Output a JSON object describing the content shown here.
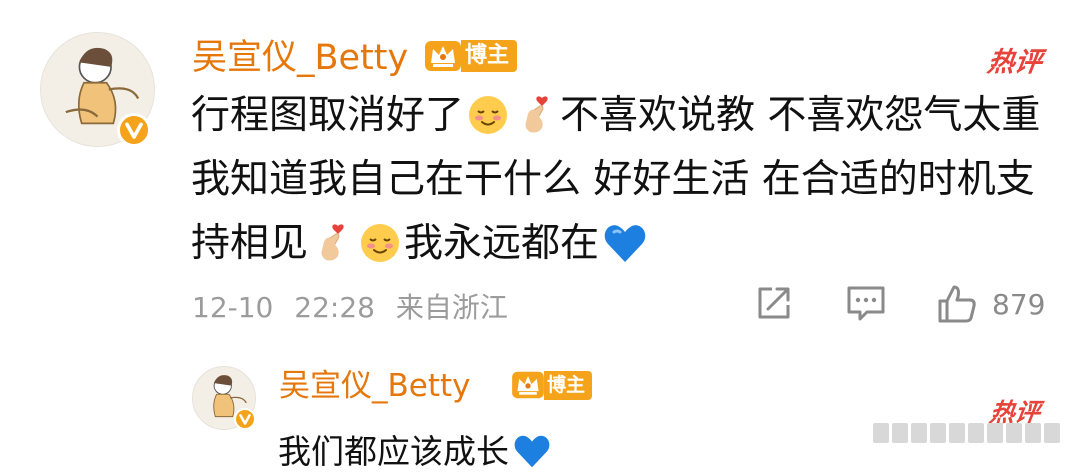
{
  "comment": {
    "username": "吴宣仪_Betty",
    "badge_label": "博主",
    "hot_label": "热评",
    "content_parts": {
      "p1": "行程图取消好了",
      "p2": "不喜欢说教 不喜欢怨气太重 我知道我自己在干什么 好好生活 在合适的时机支持相见",
      "p3": "我永远都在"
    },
    "meta": {
      "date": "12-10",
      "time": "22:28",
      "source": "来自浙江"
    },
    "actions": {
      "share_icon": "share-icon",
      "comment_icon": "comment-icon",
      "like_icon": "thumbs-up-icon",
      "like_count": "879"
    }
  },
  "reply": {
    "username": "吴宣仪_Betty",
    "badge_label": "博主",
    "hot_label": "热评",
    "text": "我们都应该成长"
  },
  "colors": {
    "username": "#e5770b",
    "badge": "#f5a31a",
    "hot": "#e8433a",
    "meta": "#9c9c9c"
  }
}
